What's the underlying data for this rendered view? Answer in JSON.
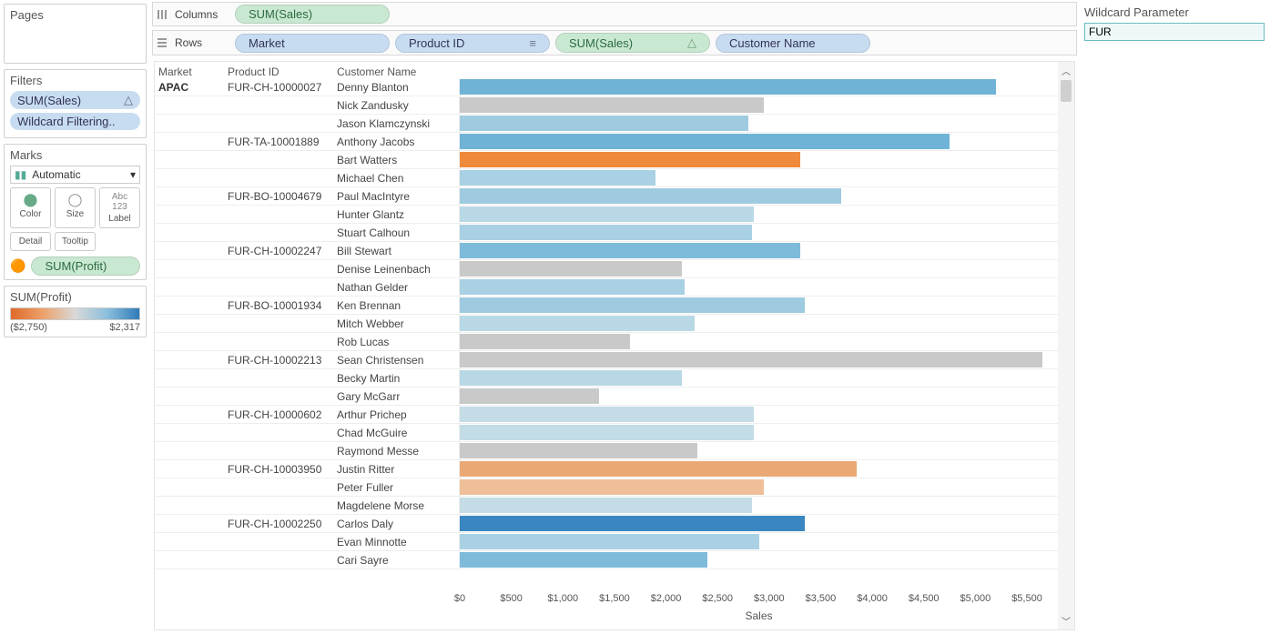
{
  "shelves": {
    "columns_label": "Columns",
    "columns_pill": "SUM(Sales)",
    "rows_label": "Rows",
    "rows_pills": [
      "Market",
      "Product ID",
      "SUM(Sales)",
      "Customer Name"
    ]
  },
  "pages": {
    "title": "Pages"
  },
  "filters": {
    "title": "Filters",
    "items": [
      "SUM(Sales)",
      "Wildcard Filtering.."
    ]
  },
  "marks": {
    "title": "Marks",
    "type_label": "Automatic",
    "buttons": [
      "Color",
      "Size",
      "Label",
      "Detail",
      "Tooltip"
    ],
    "color_pill": "SUM(Profit)"
  },
  "legend": {
    "title": "SUM(Profit)",
    "min": "($2,750)",
    "max": "$2,317"
  },
  "parameter": {
    "title": "Wildcard Parameter",
    "value": "FUR"
  },
  "headers": {
    "market": "Market",
    "product": "Product ID",
    "customer": "Customer Name"
  },
  "axis": {
    "label": "Sales",
    "max": 5800,
    "ticks": [
      "$0",
      "$500",
      "$1,000",
      "$1,500",
      "$2,000",
      "$2,500",
      "$3,000",
      "$3,500",
      "$4,000",
      "$4,500",
      "$5,000",
      "$5,500"
    ],
    "tick_values": [
      0,
      500,
      1000,
      1500,
      2000,
      2500,
      3000,
      3500,
      4000,
      4500,
      5000,
      5500
    ]
  },
  "chart_data": {
    "type": "bar",
    "xlabel": "Sales",
    "xlim": [
      0,
      5800
    ],
    "color_encoding": "SUM(Profit)",
    "color_scale": {
      "min": -2750,
      "mid": 0,
      "max": 2317,
      "min_color": "#e06a2b",
      "mid_color": "#c9c9c9",
      "max_color": "#2f7bb8"
    },
    "market": "APAC",
    "rows": [
      {
        "product": "FUR-CH-10000027",
        "customer": "Denny Blanton",
        "sales": 5200,
        "color": "#6fb3d6"
      },
      {
        "product": "",
        "customer": "Nick Zandusky",
        "sales": 2950,
        "color": "#c9c9c9"
      },
      {
        "product": "",
        "customer": "Jason Klamczynski",
        "sales": 2800,
        "color": "#9fcbe0"
      },
      {
        "product": "FUR-TA-10001889",
        "customer": "Anthony Jacobs",
        "sales": 4750,
        "color": "#6fb3d6"
      },
      {
        "product": "",
        "customer": "Bart Watters",
        "sales": 3300,
        "color": "#ef8a3c"
      },
      {
        "product": "",
        "customer": "Michael Chen",
        "sales": 1900,
        "color": "#a9d1e3"
      },
      {
        "product": "FUR-BO-10004679",
        "customer": "Paul MacIntyre",
        "sales": 3700,
        "color": "#9fcbe0"
      },
      {
        "product": "",
        "customer": "Hunter Glantz",
        "sales": 2850,
        "color": "#b9d8e5"
      },
      {
        "product": "",
        "customer": "Stuart Calhoun",
        "sales": 2830,
        "color": "#a9d1e3"
      },
      {
        "product": "FUR-CH-10002247",
        "customer": "Bill Stewart",
        "sales": 3300,
        "color": "#7ebbdb"
      },
      {
        "product": "",
        "customer": "Denise Leinenbach",
        "sales": 2150,
        "color": "#c9c9c9"
      },
      {
        "product": "",
        "customer": "Nathan Gelder",
        "sales": 2180,
        "color": "#a9d1e3"
      },
      {
        "product": "FUR-BO-10001934",
        "customer": "Ken Brennan",
        "sales": 3350,
        "color": "#9fcbe0"
      },
      {
        "product": "",
        "customer": "Mitch Webber",
        "sales": 2280,
        "color": "#b9d8e5"
      },
      {
        "product": "",
        "customer": "Rob Lucas",
        "sales": 1650,
        "color": "#c9c9c9"
      },
      {
        "product": "FUR-CH-10002213",
        "customer": "Sean Christensen",
        "sales": 5650,
        "color": "#c9c9c9"
      },
      {
        "product": "",
        "customer": "Becky Martin",
        "sales": 2150,
        "color": "#b9d8e5"
      },
      {
        "product": "",
        "customer": "Gary McGarr",
        "sales": 1350,
        "color": "#c9c9c9"
      },
      {
        "product": "FUR-CH-10000602",
        "customer": "Arthur Prichep",
        "sales": 2850,
        "color": "#c3dce6"
      },
      {
        "product": "",
        "customer": "Chad McGuire",
        "sales": 2850,
        "color": "#c3dce6"
      },
      {
        "product": "",
        "customer": "Raymond Messe",
        "sales": 2300,
        "color": "#c9c9c9"
      },
      {
        "product": "FUR-CH-10003950",
        "customer": "Justin Ritter",
        "sales": 3850,
        "color": "#eaa874"
      },
      {
        "product": "",
        "customer": "Peter Fuller",
        "sales": 2950,
        "color": "#eebf98"
      },
      {
        "product": "",
        "customer": "Magdelene Morse",
        "sales": 2830,
        "color": "#c3dce6"
      },
      {
        "product": "FUR-CH-10002250",
        "customer": "Carlos Daly",
        "sales": 3350,
        "color": "#3a86c0"
      },
      {
        "product": "",
        "customer": "Evan Minnotte",
        "sales": 2900,
        "color": "#a9d1e3"
      },
      {
        "product": "",
        "customer": "Cari Sayre",
        "sales": 2400,
        "color": "#7ebbdb"
      }
    ]
  }
}
